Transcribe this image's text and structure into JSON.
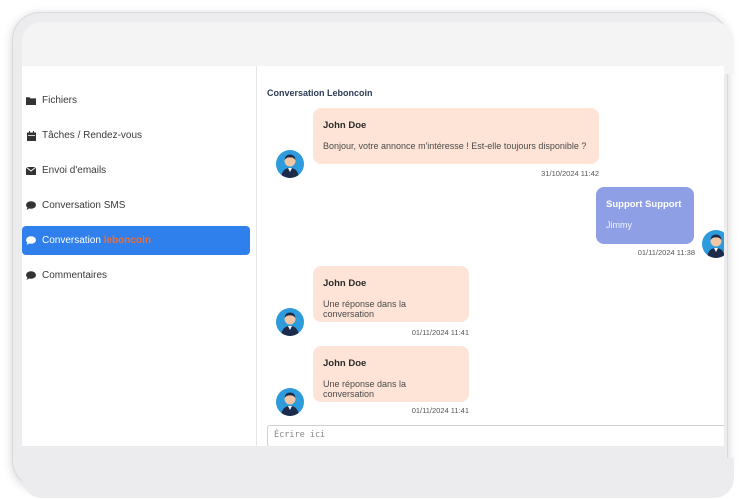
{
  "sidebar": {
    "items": [
      {
        "label": "Fichiers",
        "icon": "folder-icon"
      },
      {
        "label": "Tâches / Rendez-vous",
        "icon": "calendar-icon"
      },
      {
        "label": "Envoi d'emails",
        "icon": "envelope-icon"
      },
      {
        "label": "Conversation SMS",
        "icon": "chat-bubble-icon"
      },
      {
        "label": "Conversation ",
        "brand": "leboncoin",
        "icon": "chat-bubble-icon",
        "active": true
      },
      {
        "label": "Commentaires",
        "icon": "chat-bubble-icon"
      }
    ]
  },
  "conversation": {
    "title": "Conversation Leboncoin",
    "messages": [
      {
        "author": "John Doe",
        "text": "Bonjour, votre annonce m'intéresse ! Est-elle toujours disponible ?",
        "time": "31/10/2024 11:42",
        "side": "left"
      },
      {
        "author": "Support Support",
        "text": "Jimmy",
        "time": "01/11/2024 11:38",
        "side": "right"
      },
      {
        "author": "John Doe",
        "text": "Une réponse dans la conversation",
        "time": "01/11/2024 11:41",
        "side": "left"
      },
      {
        "author": "John Doe",
        "text": "Une réponse dans la conversation",
        "time": "01/11/2024 11:41",
        "side": "left"
      }
    ],
    "input_placeholder": "Écrire ici"
  },
  "colors": {
    "active_item": "#2f80ed",
    "brand": "#f56b2a",
    "incoming_bubble": "#fde4d6",
    "outgoing_bubble": "#8e9fe6"
  }
}
